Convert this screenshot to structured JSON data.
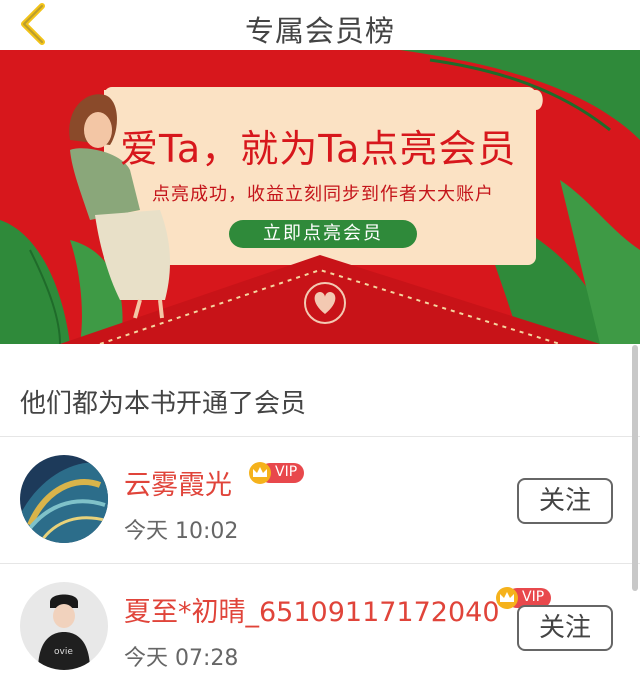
{
  "header": {
    "title": "专属会员榜",
    "back_icon": "chevron-left-icon"
  },
  "banner": {
    "title": "爱Ta，就为Ta点亮会员",
    "subtitle": "点亮成功，收益立刻同步到作者大大账户",
    "cta_label": "立即点亮会员",
    "colors": {
      "background": "#d7171c",
      "card": "#fbe2c4",
      "leaf": "#2f8a3a",
      "cta": "#2f8a3a"
    }
  },
  "section": {
    "heading": "他们都为本书开通了会员"
  },
  "members": [
    {
      "name": "云雾霞光",
      "badge": "VIP",
      "time": "今天 10:02",
      "follow_label": "关注"
    },
    {
      "name": "夏至*初晴_65109117172040",
      "badge": "VIP",
      "time": "今天 07:28",
      "follow_label": "关注"
    }
  ],
  "colors": {
    "name": "#e0443a",
    "vip": "#e8484c",
    "crown": "#f5b21c"
  }
}
